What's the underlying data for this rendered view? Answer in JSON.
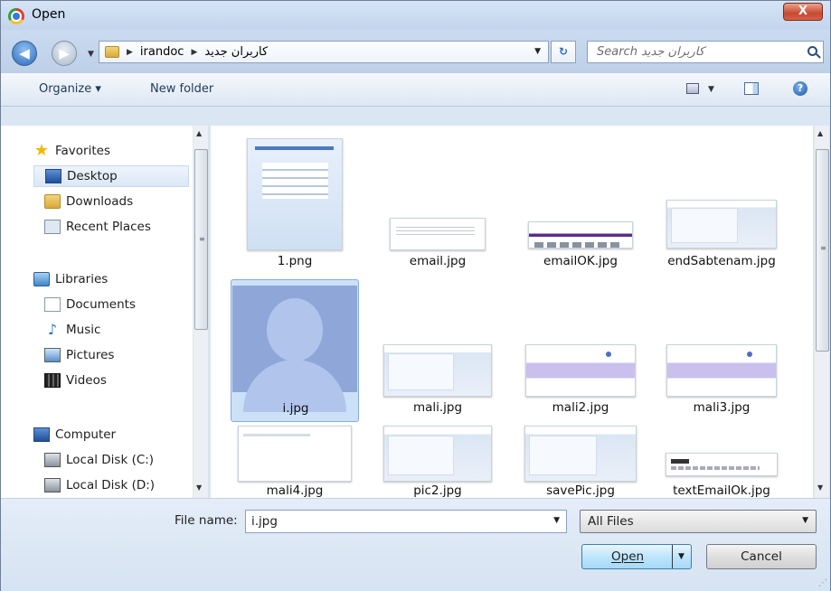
{
  "window": {
    "title": "Open",
    "close_symbol": "X"
  },
  "address": {
    "crumbs": [
      "irandoc",
      "کاربران جدید"
    ],
    "search_placeholder": "Search کاربران جدید"
  },
  "toolbar": {
    "organize": "Organize ▾",
    "new_folder": "New folder",
    "help": "?"
  },
  "nav": {
    "favorites_header": "Favorites",
    "favorites": [
      "Desktop",
      "Downloads",
      "Recent Places"
    ],
    "libraries_header": "Libraries",
    "libraries": [
      "Documents",
      "Music",
      "Pictures",
      "Videos"
    ],
    "computer_header": "Computer",
    "drives": [
      "Local Disk (C:)",
      "Local Disk (D:)"
    ],
    "selected": "Desktop"
  },
  "files": [
    {
      "name": "1.png",
      "thumb": "form"
    },
    {
      "name": "email.jpg",
      "thumb": "lines"
    },
    {
      "name": "emailOK.jpg",
      "thumb": "purple"
    },
    {
      "name": "endSabtenam.jpg",
      "thumb": "blue"
    },
    {
      "name": "i.jpg",
      "thumb": "avatar",
      "selected": true
    },
    {
      "name": "mali.jpg",
      "thumb": "blue"
    },
    {
      "name": "mali2.jpg",
      "thumb": "violet"
    },
    {
      "name": "mali3.jpg",
      "thumb": "violet"
    },
    {
      "name": "mali4.jpg",
      "thumb": "plain"
    },
    {
      "name": "pic2.jpg",
      "thumb": "blue"
    },
    {
      "name": "savePic.jpg",
      "thumb": "blue"
    },
    {
      "name": "textEmailOk.jpg",
      "thumb": "dark"
    }
  ],
  "footer": {
    "file_name_label": "File name:",
    "file_name_value": "i.jpg",
    "file_type": "All Files",
    "open_label": "Open",
    "cancel_label": "Cancel"
  }
}
